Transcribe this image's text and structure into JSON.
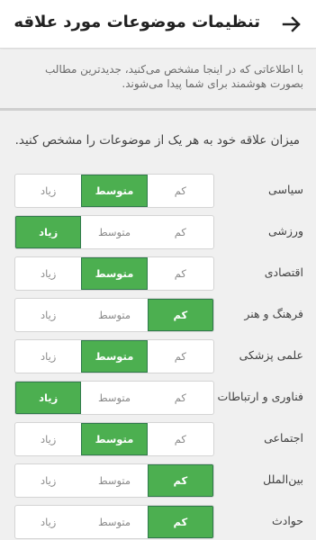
{
  "header": {
    "title": "تنظیمات موضوعات مورد علاقه",
    "back_icon": "arrow-right-icon"
  },
  "intro": {
    "text": "با اطلاعاتی که در اینجا مشخص می‌کنید، جدیدترین مطالب بصورت هوشمند برای شما پیدا می‌شوند."
  },
  "prompt": {
    "text": "میزان علاقه خود به هر یک از موضوعات را مشخص کنید."
  },
  "levels": {
    "low": "کم",
    "medium": "متوسط",
    "high": "زیاد"
  },
  "colors": {
    "selected": "#4caf50",
    "selected_border": "#2f7a4a"
  },
  "topics": [
    {
      "label": "سیاسی",
      "selected": "medium"
    },
    {
      "label": "ورزشی",
      "selected": "high"
    },
    {
      "label": "اقتصادی",
      "selected": "medium"
    },
    {
      "label": "فرهنگ و هنر",
      "selected": "low"
    },
    {
      "label": "علمی پزشکی",
      "selected": "medium"
    },
    {
      "label": "فناوری و ارتباطات",
      "selected": "high"
    },
    {
      "label": "اجتماعی",
      "selected": "medium"
    },
    {
      "label": "بین‌الملل",
      "selected": "low"
    },
    {
      "label": "حوادث",
      "selected": "low"
    }
  ]
}
